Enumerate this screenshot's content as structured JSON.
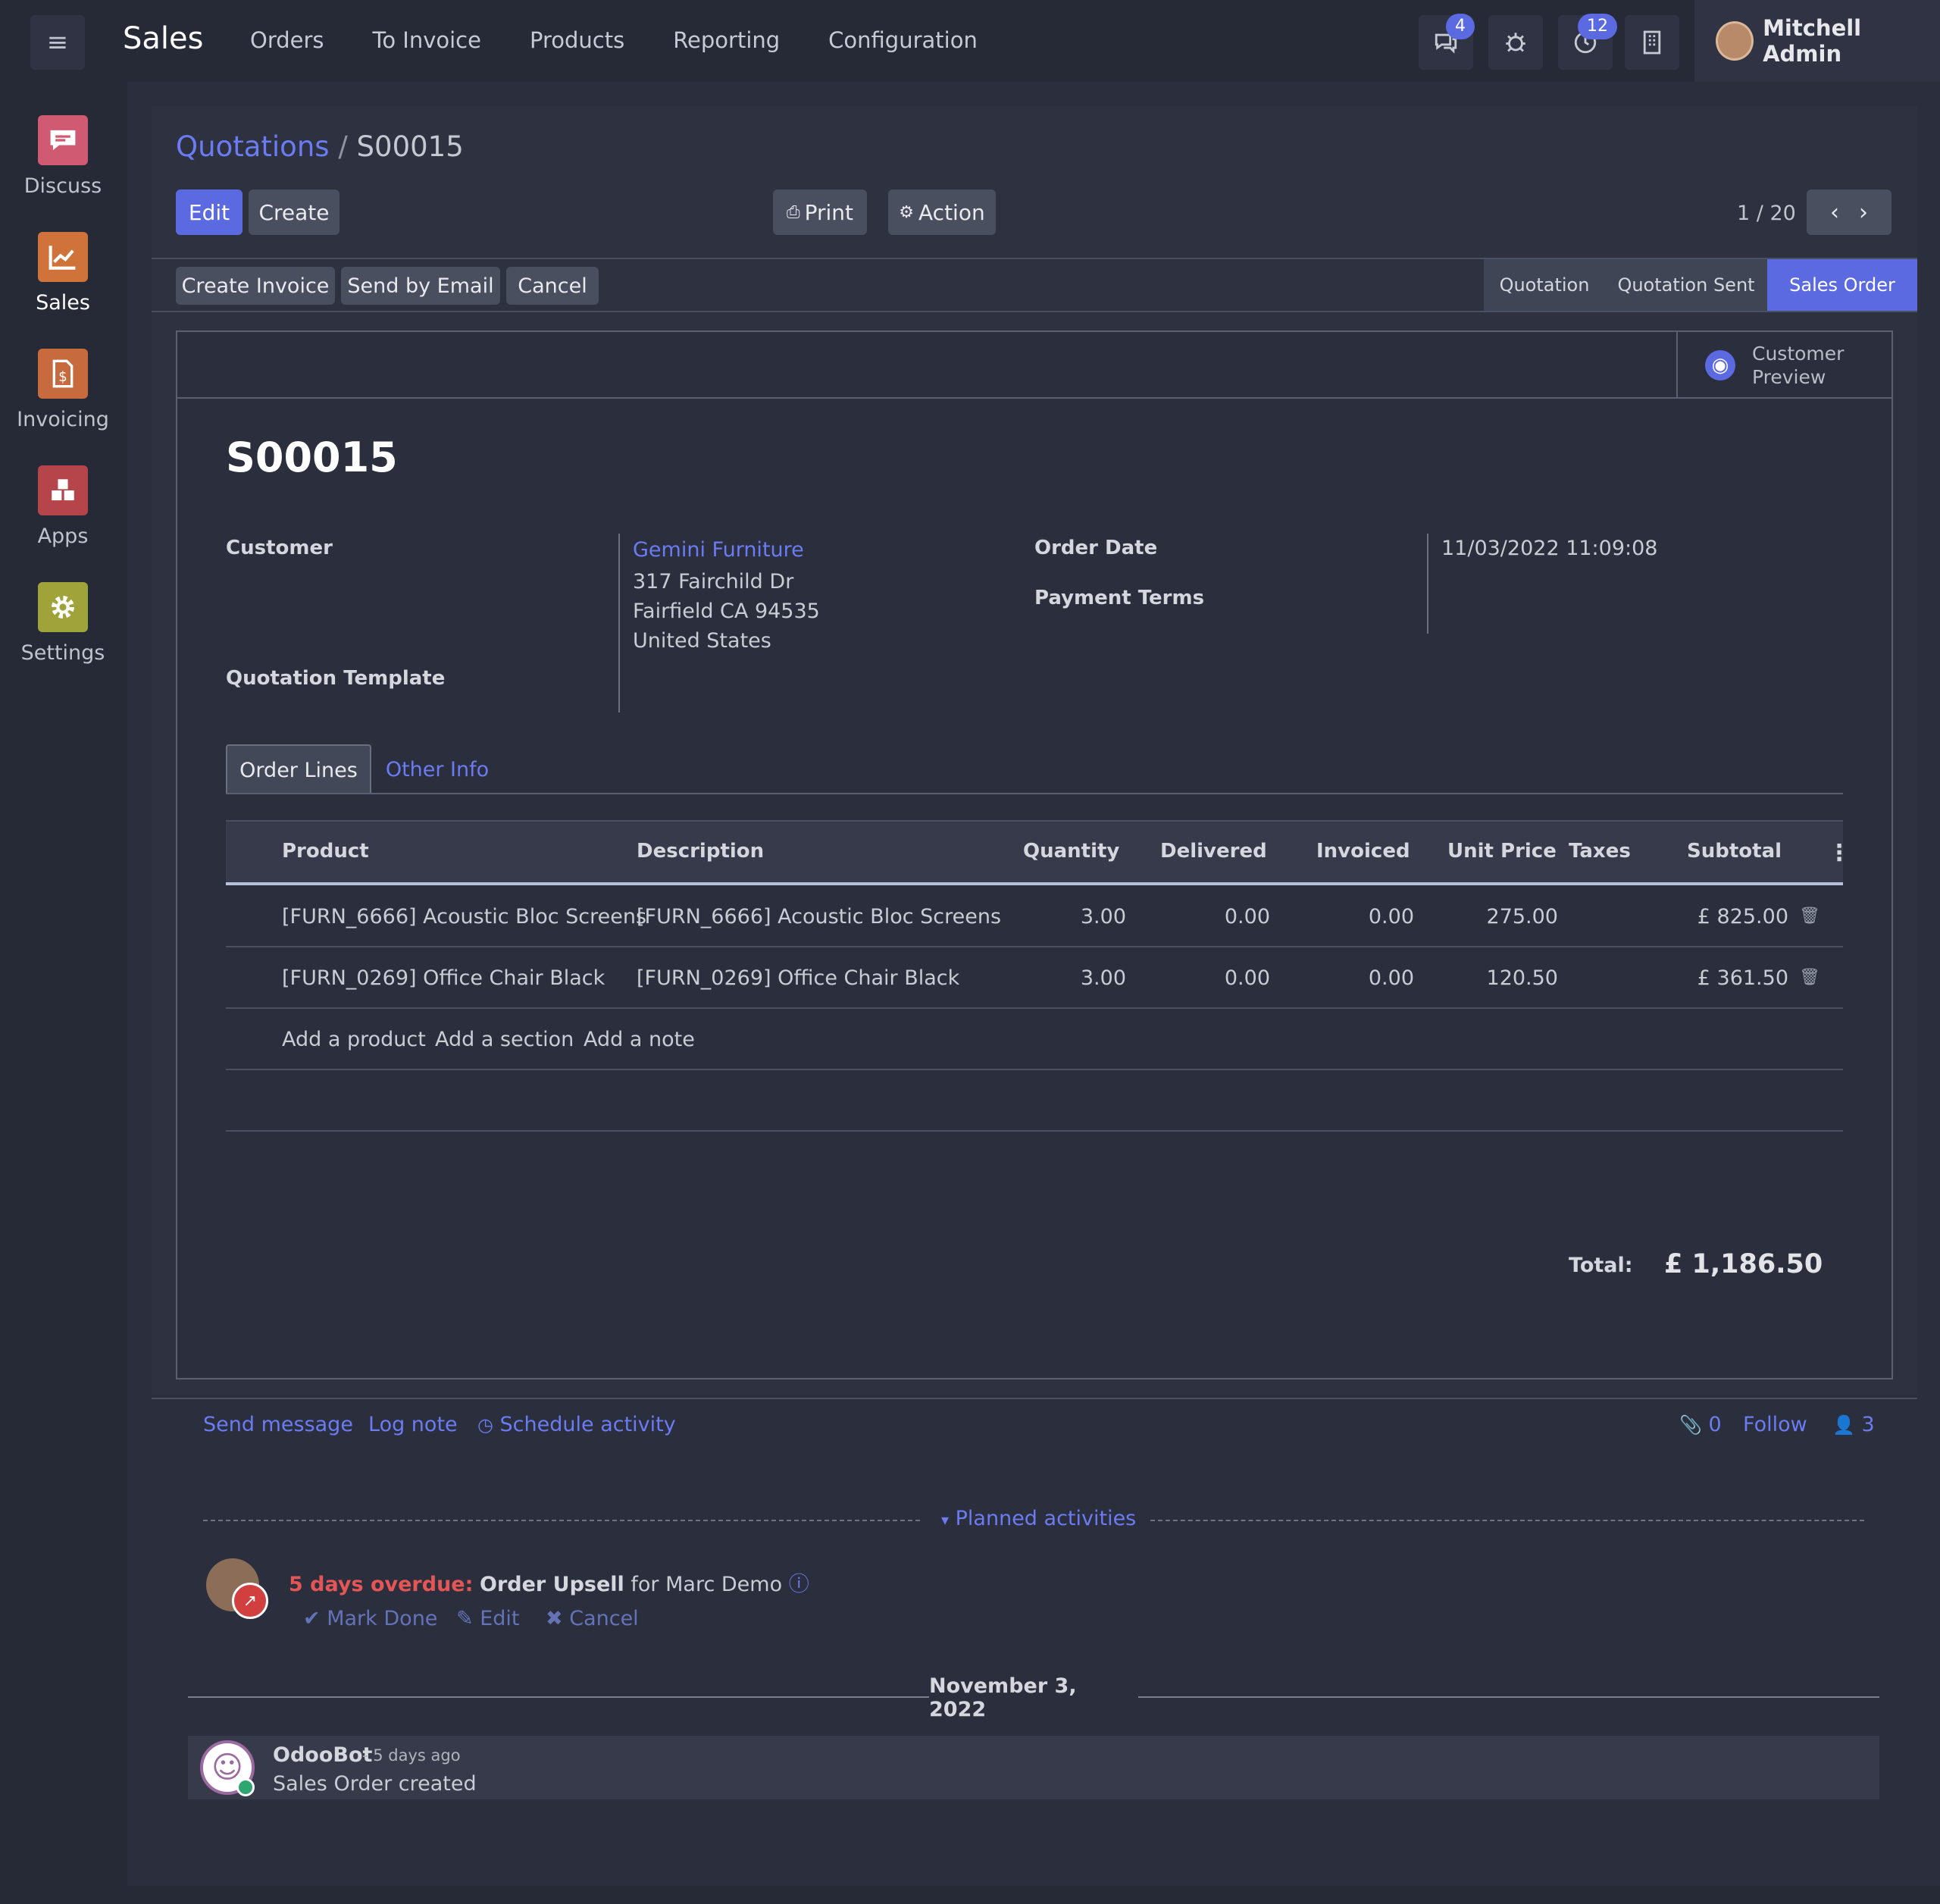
{
  "topbar": {
    "app_title": "Sales",
    "menu": [
      "Orders",
      "To Invoice",
      "Products",
      "Reporting",
      "Configuration"
    ],
    "messages_badge": "4",
    "activities_badge": "12",
    "user_name": "Mitchell Admin"
  },
  "sidebar": {
    "apps": [
      {
        "label": "Discuss",
        "icon": "chat-bubble-icon",
        "color": "#d05a72"
      },
      {
        "label": "Sales",
        "icon": "chart-line-icon",
        "color": "#d0733a"
      },
      {
        "label": "Invoicing",
        "icon": "invoice-dollar-icon",
        "color": "#c76a3e"
      },
      {
        "label": "Apps",
        "icon": "cubes-icon",
        "color": "#b5454a"
      },
      {
        "label": "Settings",
        "icon": "gear-icon",
        "color": "#a0a23a"
      }
    ]
  },
  "breadcrumb": {
    "parent": "Quotations",
    "separator": "/",
    "current": "S00015"
  },
  "buttons": {
    "edit": "Edit",
    "create": "Create",
    "print": "Print",
    "action": "Action",
    "create_invoice": "Create Invoice",
    "send_by_email": "Send by Email",
    "cancel": "Cancel"
  },
  "pager": {
    "value": "1 / 20"
  },
  "status_stages": [
    "Quotation",
    "Quotation Sent",
    "Sales Order"
  ],
  "active_stage": "Sales Order",
  "customer_preview": {
    "line1": "Customer",
    "line2": "Preview"
  },
  "record": {
    "name": "S00015",
    "labels": {
      "customer": "Customer",
      "quotation_template": "Quotation Template",
      "order_date": "Order Date",
      "payment_terms": "Payment Terms"
    },
    "customer_name": "Gemini Furniture",
    "customer_address": [
      "317 Fairchild Dr",
      "Fairfield CA 94535",
      "United States"
    ],
    "order_date": "11/03/2022 11:09:08"
  },
  "tabs": [
    "Order Lines",
    "Other Info"
  ],
  "table": {
    "columns": [
      "Product",
      "Description",
      "Quantity",
      "Delivered",
      "Invoiced",
      "Unit Price",
      "Taxes",
      "Subtotal"
    ],
    "rows": [
      {
        "product": "[FURN_6666] Acoustic Bloc Screens",
        "description": "[FURN_6666] Acoustic Bloc Screens",
        "quantity": "3.00",
        "delivered": "0.00",
        "invoiced": "0.00",
        "unit_price": "275.00",
        "taxes": "",
        "subtotal": "£ 825.00"
      },
      {
        "product": "[FURN_0269] Office Chair Black",
        "description": "[FURN_0269] Office Chair Black",
        "quantity": "3.00",
        "delivered": "0.00",
        "invoiced": "0.00",
        "unit_price": "120.50",
        "taxes": "",
        "subtotal": "£ 361.50"
      }
    ],
    "add_links": [
      "Add a product",
      "Add a section",
      "Add a note"
    ]
  },
  "totals": {
    "label": "Total:",
    "value": "£ 1,186.50"
  },
  "chatter": {
    "send_message": "Send message",
    "log_note": "Log note",
    "schedule_activity": "Schedule activity",
    "attachments_count": "0",
    "follow": "Follow",
    "followers_count": "3",
    "planned_activities": "Planned activities",
    "activity": {
      "overdue": "5 days overdue:",
      "name": "Order Upsell",
      "for_text": "for Marc Demo",
      "mark_done": "Mark Done",
      "edit": "Edit",
      "cancel": "Cancel"
    },
    "date_separator": "November 3, 2022",
    "message": {
      "author": "OdooBot",
      "time": "- 5 days ago",
      "body": "Sales Order created"
    }
  }
}
